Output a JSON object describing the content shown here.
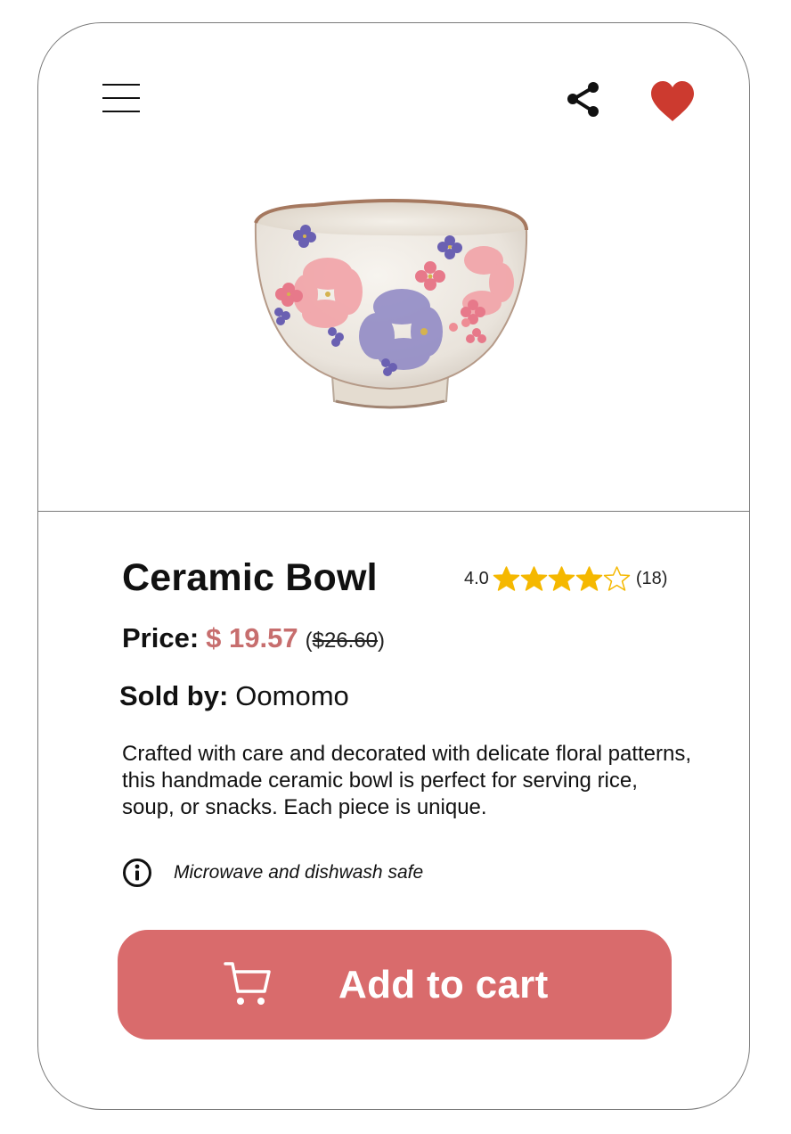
{
  "header": {
    "menu_icon": "hamburger-menu-icon",
    "share_icon": "share-icon",
    "favorite_icon": "heart-icon",
    "favorite_color": "#cc3a2f",
    "favorited": true
  },
  "product": {
    "image_subject": "ceramic bowl with pink and purple floral pattern",
    "title": "Ceramic Bowl",
    "rating": {
      "value": "4.0",
      "stars": 4,
      "max_stars": 5,
      "count": "(18)",
      "star_color": "#f5b800"
    },
    "price_label": "Price:",
    "price": "$ 19.57",
    "old_price_open": "(",
    "old_price": "$26.60",
    "old_price_close": ")",
    "price_color": "#c76e6e",
    "seller_label": "Sold by:",
    "seller": "Oomomo",
    "description": "Crafted with care and decorated with delicate floral patterns, this handmade ceramic bowl is perfect for serving rice, soup, or snacks. Each piece is unique.",
    "info_icon": "info-icon",
    "info_text": "Microwave and dishwash safe"
  },
  "cart_button": {
    "icon": "shopping-cart-icon",
    "label": "Add to cart",
    "background": "#d96b6c"
  }
}
